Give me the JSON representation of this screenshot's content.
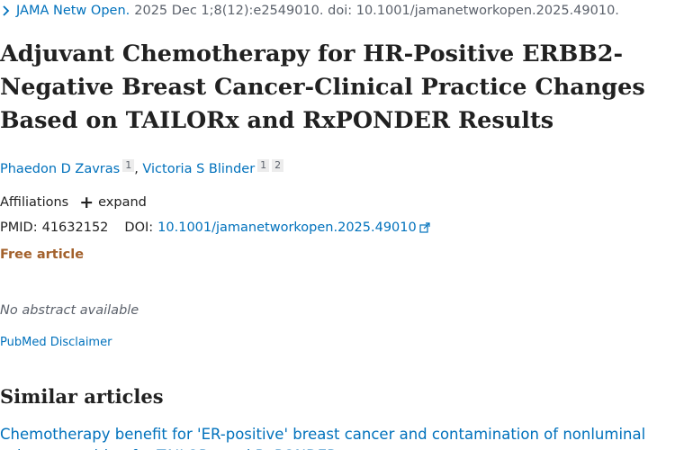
{
  "citation": {
    "journal": "JAMA Netw Open.",
    "details": "2025 Dec 1;8(12):e2549010. doi: 10.1001/jamanetworkopen.2025.49010."
  },
  "article": {
    "title": "Adjuvant Chemotherapy for HR-Positive ERBB2-Negative Breast Cancer-Clinical Practice Changes Based on TAILORx and RxPONDER Results",
    "authors": [
      {
        "name": "Phaedon D Zavras",
        "affiliations": [
          "1"
        ]
      },
      {
        "name": "Victoria S Blinder",
        "affiliations": [
          "1",
          "2"
        ]
      }
    ],
    "author_separator": ", "
  },
  "affiliations": {
    "label": "Affiliations",
    "expand_label": "expand"
  },
  "ids": {
    "pmid_label": "PMID:",
    "pmid": "41632152",
    "doi_label": "DOI:",
    "doi": "10.1001/jamanetworkopen.2025.49010"
  },
  "access": {
    "free_label": "Free article"
  },
  "abstract": {
    "none_text": "No abstract available"
  },
  "disclaimer": {
    "label": "PubMed Disclaimer"
  },
  "similar": {
    "heading": "Similar articles",
    "first_article": "Chemotherapy benefit for 'ER-positive' breast cancer and contamination of nonluminal subtypes-waiting for TAILORx and RxPONDER."
  },
  "colors": {
    "link": "#0071bc",
    "text": "#212121",
    "muted": "#5b616b",
    "free_article": "#a3612c"
  },
  "icons": {
    "journal_chevron": "chevron-right-icon",
    "expand": "plus-icon",
    "doi_external": "external-link-icon"
  }
}
